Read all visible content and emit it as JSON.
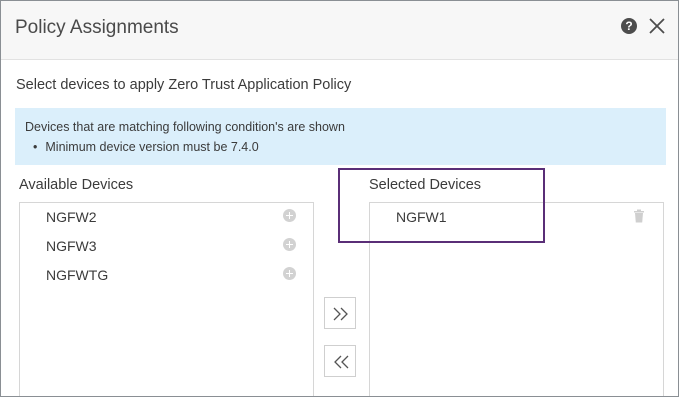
{
  "dialog": {
    "title": "Policy Assignments",
    "help_icon": "help-icon",
    "close_icon": "close-icon"
  },
  "subtitle": "Select devices to apply Zero Trust Application Policy",
  "info": {
    "line1": "Devices that are matching following condition's are shown",
    "bullet": "•",
    "line2": "Minimum device version must be 7.4.0"
  },
  "available": {
    "label": "Available Devices",
    "items": [
      {
        "name": "NGFW2",
        "icon": "add-icon"
      },
      {
        "name": "NGFW3",
        "icon": "add-icon"
      },
      {
        "name": "NGFWTG",
        "icon": "add-icon"
      }
    ]
  },
  "selected": {
    "label": "Selected Devices",
    "items": [
      {
        "name": "NGFW1",
        "icon": "trash-icon"
      }
    ]
  },
  "buttons": {
    "move_right_icon": "double-chevron-right-icon",
    "move_left_icon": "double-chevron-left-icon"
  },
  "colors": {
    "info_bg": "#dbeffb",
    "highlight_border": "#5a2e77",
    "header_bg": "#f7f7f7"
  }
}
